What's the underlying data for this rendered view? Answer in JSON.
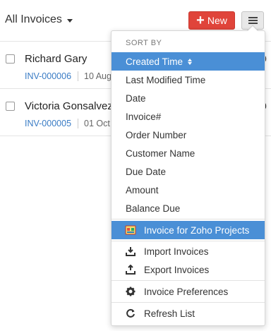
{
  "header": {
    "view_title": "All Invoices",
    "new_label": "New",
    "accent_color": "#e0443a"
  },
  "rows": [
    {
      "name": "Richard Gary",
      "invoice": "INV-000006",
      "date": "10 Aug",
      "amount_tail": "0"
    },
    {
      "name": "Victoria Gonsalvez",
      "invoice": "INV-000005",
      "date": "01 Oct",
      "amount_tail": "0"
    }
  ],
  "menu": {
    "sort_header": "SORT BY",
    "sort_items": [
      "Created Time",
      "Last Modified Time",
      "Date",
      "Invoice#",
      "Order Number",
      "Customer Name",
      "Due Date",
      "Amount",
      "Balance Due"
    ],
    "active_sort": "Created Time",
    "projects_item": "Invoice for Zoho Projects",
    "import_item": "Import Invoices",
    "export_item": "Export Invoices",
    "preferences_item": "Invoice Preferences",
    "refresh_item": "Refresh List",
    "highlight_color": "#4a8fd6"
  }
}
